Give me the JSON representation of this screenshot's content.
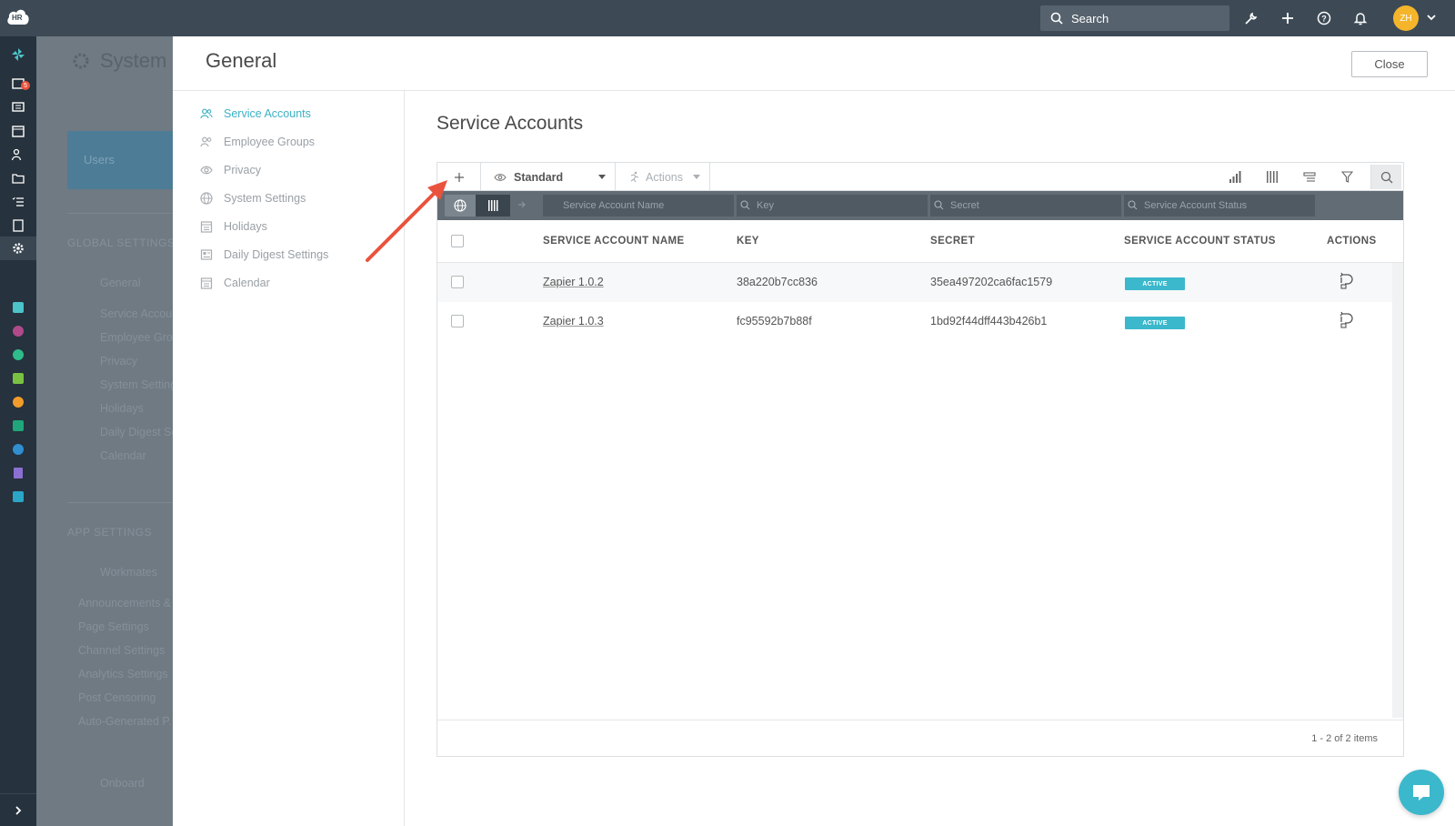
{
  "app": {
    "logo_text": "HR",
    "search_label": "Search",
    "avatar_initials": "ZH",
    "rail_badge": "5"
  },
  "background_page": {
    "title": "System Settings",
    "card_label": "Users",
    "section_global": "GLOBAL SETTINGS",
    "global_items": [
      "General",
      "Service Accounts",
      "Employee Groups",
      "Privacy",
      "System Settings",
      "Holidays",
      "Daily Digest Settings",
      "Calendar"
    ],
    "section_app": "APP SETTINGS",
    "app_items": [
      "Workmates",
      "Announcements & ...",
      "Page Settings",
      "Channel Settings",
      "Analytics Settings",
      "Post Censoring",
      "Auto-Generated P..."
    ],
    "bottom_item": "Onboard"
  },
  "modal": {
    "title": "General",
    "close_label": "Close",
    "nav": [
      {
        "label": "Service Accounts",
        "icon": "users-icon",
        "active": true
      },
      {
        "label": "Employee Groups",
        "icon": "users-icon",
        "active": false
      },
      {
        "label": "Privacy",
        "icon": "eye-icon",
        "active": false
      },
      {
        "label": "System Settings",
        "icon": "globe-icon",
        "active": false
      },
      {
        "label": "Holidays",
        "icon": "calendar-icon",
        "active": false
      },
      {
        "label": "Daily Digest Settings",
        "icon": "digest-icon",
        "active": false
      },
      {
        "label": "Calendar",
        "icon": "calendar-icon",
        "active": false
      }
    ],
    "content_title": "Service Accounts",
    "toolbar": {
      "view_label": "Standard",
      "actions_label": "Actions"
    },
    "filters": {
      "name": "Service Account Name",
      "key": "Key",
      "secret": "Secret",
      "status": "Service Account Status"
    },
    "columns": [
      "SERVICE ACCOUNT NAME",
      "KEY",
      "SECRET",
      "SERVICE ACCOUNT STATUS",
      "ACTIONS"
    ],
    "rows": [
      {
        "name": "Zapier 1.0.2",
        "key": "38a220b7cc836",
        "secret": "35ea497202ca6fac1579",
        "status": "ACTIVE"
      },
      {
        "name": "Zapier 1.0.3",
        "key": "fc95592b7b88f",
        "secret": "1bd92f44dff443b426b1",
        "status": "ACTIVE"
      }
    ],
    "pager": "1 - 2 of 2 items"
  },
  "colors": {
    "accent": "#3bb1c4",
    "topbar": "#3d4a56",
    "rail": "#26323d",
    "annotation": "#e9533d"
  }
}
